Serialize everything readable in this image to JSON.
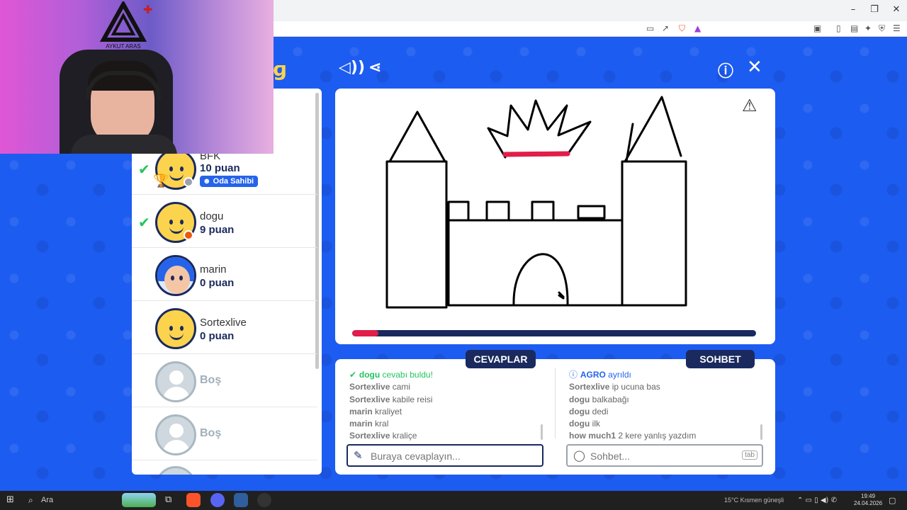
{
  "players": [
    {
      "name": "BFK",
      "points": "10 puan",
      "correct": true,
      "badge": "Oda Sahibi",
      "status_color": "#9ca3af"
    },
    {
      "name": "dogu",
      "points": "9 puan",
      "correct": true,
      "status_color": "#ea580c"
    },
    {
      "name": "marin",
      "points": "0 puan",
      "correct": false
    },
    {
      "name": "Sortexlive",
      "points": "0 puan",
      "correct": false
    },
    {
      "name": "Boş"
    },
    {
      "name": "Boş"
    }
  ],
  "canvas": {
    "timer_fraction": 0.065,
    "timer_color": "#e11d48",
    "crown_band_color": "#e11d48"
  },
  "answers": {
    "tab_label": "CEVAPLAR",
    "placeholder": "Buraya cevaplayın...",
    "messages": [
      {
        "user": "dogu",
        "text": "cevabı buldu!",
        "type": "correct"
      },
      {
        "user": "Sortexlive",
        "text": "cami"
      },
      {
        "user": "Sortexlive",
        "text": "kabile reisi"
      },
      {
        "user": "marin",
        "text": "kraliyet"
      },
      {
        "user": "marin",
        "text": "kral"
      },
      {
        "user": "Sortexlive",
        "text": "kraliçe"
      }
    ]
  },
  "chat": {
    "tab_label": "SOHBET",
    "placeholder": "Sohbet...",
    "tab_key": "tab",
    "messages": [
      {
        "user": "AGRO",
        "text": "ayrıldı",
        "type": "system"
      },
      {
        "user": "Sortexlive",
        "text": "ip ucuna bas"
      },
      {
        "user": "dogu",
        "text": "balkabağı"
      },
      {
        "user": "dogu",
        "text": "dedi"
      },
      {
        "user": "dogu",
        "text": "ilk"
      },
      {
        "user": "how much1",
        "text": "2 kere yanlış yazdım"
      }
    ]
  },
  "webcam": {
    "logo_text": "AYKUT ARAS"
  },
  "taskbar": {
    "search_label": "Ara",
    "weather": "15°C  Kısmen güneşli",
    "time": "19:49",
    "date": "24.04.2026"
  },
  "colors": {
    "game_bg": "#1d5cf0",
    "navy": "#1a2a5e",
    "correct": "#22c55e"
  }
}
